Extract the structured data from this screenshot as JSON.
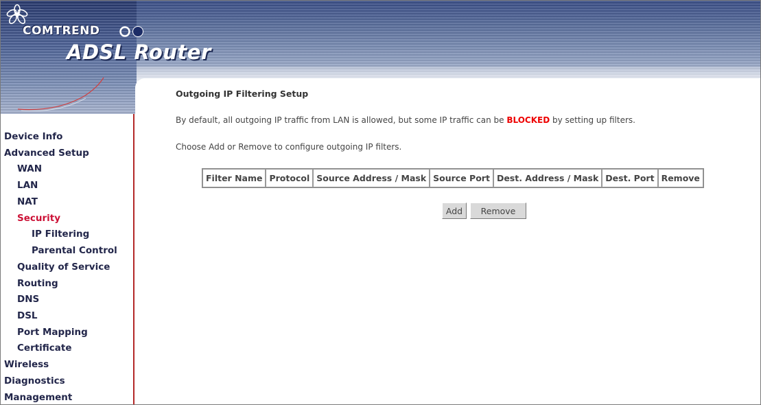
{
  "header": {
    "brand": "COMTREND",
    "product": "ADSL Router"
  },
  "menu": {
    "items": [
      {
        "label": "Device Info"
      },
      {
        "label": "Advanced Setup"
      },
      {
        "label": "WAN"
      },
      {
        "label": "LAN"
      },
      {
        "label": "NAT"
      },
      {
        "label": "Security"
      },
      {
        "label": "IP Filtering"
      },
      {
        "label": "Parental Control"
      },
      {
        "label": "Quality of Service"
      },
      {
        "label": "Routing"
      },
      {
        "label": "DNS"
      },
      {
        "label": "DSL"
      },
      {
        "label": "Port Mapping"
      },
      {
        "label": "Certificate"
      },
      {
        "label": "Wireless"
      },
      {
        "label": "Diagnostics"
      },
      {
        "label": "Management"
      }
    ],
    "active_item": "Security"
  },
  "main": {
    "title": "Outgoing IP Filtering Setup",
    "desc1_before": "By default, all outgoing IP traffic from LAN is allowed, but some IP traffic can be ",
    "desc1_blocked": "BLOCKED",
    "desc1_after": " by setting up filters.",
    "desc2": "Choose Add or Remove to configure outgoing IP filters.",
    "table": {
      "columns": [
        "Filter Name",
        "Protocol",
        "Source Address / Mask",
        "Source Port",
        "Dest. Address / Mask",
        "Dest. Port",
        "Remove"
      ],
      "rows": []
    },
    "buttons": {
      "add": "Add",
      "remove": "Remove"
    }
  },
  "colors": {
    "menu_text": "#22264a",
    "menu_active": "#cc1136",
    "blocked": "#ee0000",
    "menu_border": "#b32828"
  }
}
